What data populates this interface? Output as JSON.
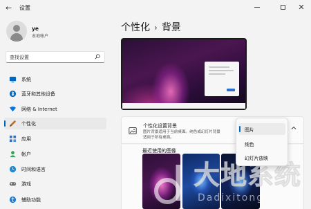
{
  "window": {
    "title": "设置",
    "back_glyph": "←",
    "close_glyph": "✕"
  },
  "user": {
    "name": "ye",
    "account_type": "本地帐户"
  },
  "search": {
    "placeholder": "查找设置"
  },
  "sidebar": {
    "items": [
      {
        "label": "系统",
        "icon": "system-icon",
        "color": "#0067c0"
      },
      {
        "label": "蓝牙和其他设备",
        "icon": "bluetooth-icon",
        "color": "#0067c0"
      },
      {
        "label": "网络 & Internet",
        "icon": "network-icon",
        "color": "#0a73d9"
      },
      {
        "label": "个性化",
        "icon": "brush-icon",
        "color": "#c76a1c",
        "active": true
      },
      {
        "label": "应用",
        "icon": "apps-icon",
        "color": "#3a6fb5"
      },
      {
        "label": "帐户",
        "icon": "account-icon",
        "color": "#2ea35a"
      },
      {
        "label": "时间和语言",
        "icon": "globe-clock-icon",
        "color": "#1f88d1"
      },
      {
        "label": "游戏",
        "icon": "game-icon",
        "color": "#6b6b6b"
      },
      {
        "label": "辅助功能",
        "icon": "accessibility-icon",
        "color": "#1b78d0"
      }
    ]
  },
  "breadcrumb": {
    "parent": "个性化",
    "separator": "›",
    "current": "背景"
  },
  "background_card": {
    "title": "个性化设置背景",
    "description_line1": "图片背景适用于当前桌面。纯色或幻灯片背景",
    "description_line2": "适用于所有桌面。"
  },
  "dropdown": {
    "options": [
      "图片",
      "纯色",
      "幻灯片放映"
    ],
    "selected": "图片"
  },
  "recent_images": {
    "label": "最近使用的图像"
  },
  "watermark": {
    "main": "大地系统",
    "sub": "Dadixitong"
  },
  "colors": {
    "accent": "#0067c0",
    "background": "#f3f3f3"
  }
}
